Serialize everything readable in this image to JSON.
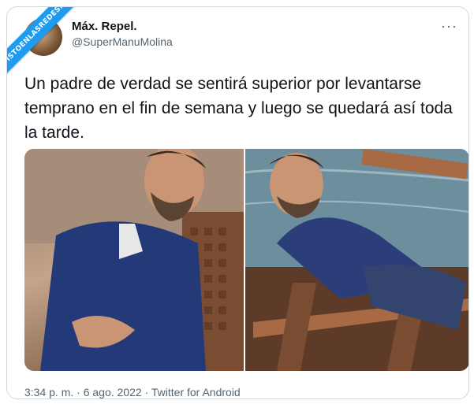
{
  "watermark": "VISTOENLASREDES.COM",
  "author": {
    "name": "Máx. Repel.",
    "handle": "@SuperManuMolina"
  },
  "more_icon": "more-horizontal-icon",
  "tweet": {
    "text": "Un padre de verdad se sentirá superior por levantarse temprano en el fin de semana y luego se quedará así toda la tarde."
  },
  "footer": {
    "time": "3:34 p. m.",
    "sep1": " · ",
    "date": "6 ago. 2022",
    "sep2": " · ",
    "source": "Twitter for Android"
  },
  "colors": {
    "accent": "#1d9bf0",
    "text": "#0f1419",
    "muted": "#536471",
    "border": "#cfd9de"
  }
}
